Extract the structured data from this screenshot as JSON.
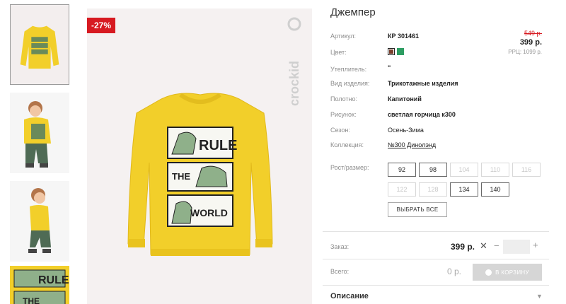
{
  "product": {
    "title": "Джемпер",
    "discount_badge": "-27%",
    "brand": "crockid"
  },
  "price": {
    "old": "549 р.",
    "current": "399 р.",
    "rrp": "РРЦ: 1099 р."
  },
  "attributes": [
    {
      "label": "Артикул:",
      "value": "КР 301461"
    },
    {
      "label": "Цвет:",
      "value": ""
    },
    {
      "label": "Утеплитель:",
      "value": "\""
    },
    {
      "label": "Вид изделия:",
      "value": "Трикотажные изделия"
    },
    {
      "label": "Полотно:",
      "value": "Капитоний"
    },
    {
      "label": "Рисунок:",
      "value": "светлая горчица к300"
    },
    {
      "label": "Сезон:",
      "value": "Осень-Зима"
    },
    {
      "label": "Коллекция:",
      "value": "№300 Динолэнд"
    }
  ],
  "colors": [
    "#7a3f2c",
    "#2e9d62"
  ],
  "sizes": {
    "label": "Рост/размер:",
    "items": [
      {
        "label": "92",
        "available": true
      },
      {
        "label": "98",
        "available": true
      },
      {
        "label": "104",
        "available": false
      },
      {
        "label": "110",
        "available": false
      },
      {
        "label": "116",
        "available": false
      },
      {
        "label": "122",
        "available": false
      },
      {
        "label": "128",
        "available": false
      },
      {
        "label": "134",
        "available": true
      },
      {
        "label": "140",
        "available": true
      }
    ],
    "select_all": "ВЫБРАТЬ ВСЕ"
  },
  "order": {
    "label": "Заказ:",
    "price": "399 р.",
    "times": "✕",
    "minus": "−",
    "plus": "+"
  },
  "total": {
    "label": "Всего:",
    "value": "0 р.",
    "cart_button": "В КОРЗИНУ"
  },
  "description": {
    "label": "Описание",
    "chevron": "▼"
  },
  "print_text": {
    "rule": "RULE",
    "the": "THE",
    "world": "WORLD"
  }
}
